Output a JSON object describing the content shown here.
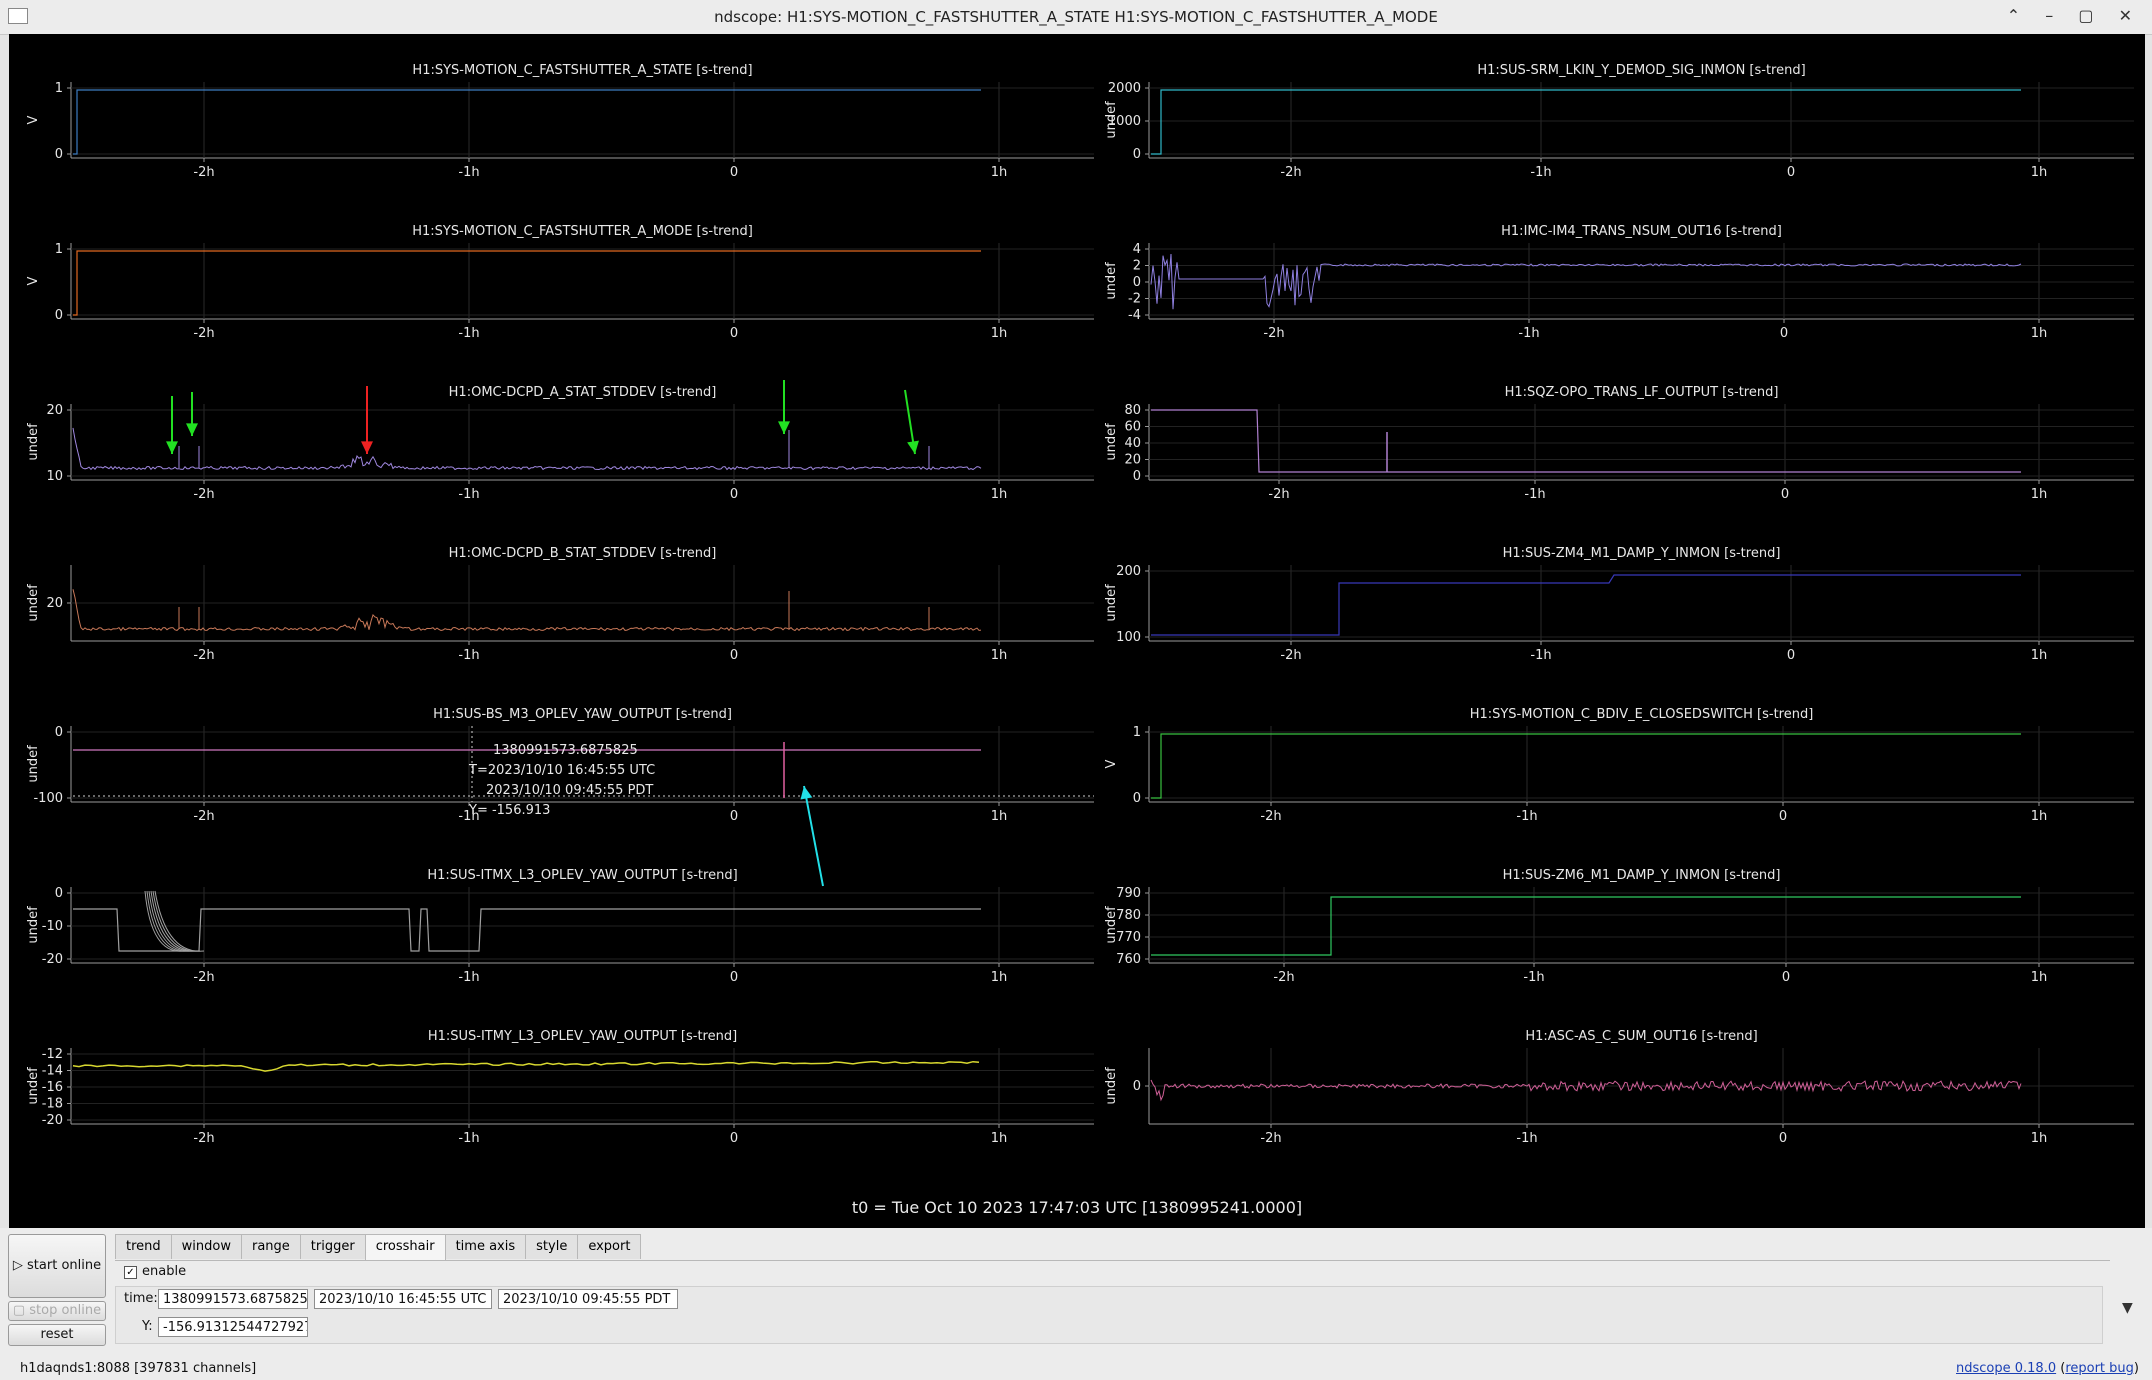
{
  "window": {
    "title": "ndscope: H1:SYS-MOTION_C_FASTSHUTTER_A_STATE H1:SYS-MOTION_C_FASTSHUTTER_A_MODE",
    "controls": [
      "⌃",
      "–",
      "▢",
      "✕"
    ]
  },
  "x_ticks": [
    "-2h",
    "-1h",
    "0",
    "1h"
  ],
  "plots": [
    {
      "title": "H1:SYS-MOTION_C_FASTSHUTTER_A_STATE [s-trend]",
      "ylabel": "V",
      "color": "#3d7cc0",
      "yticks": [
        "1",
        "0"
      ],
      "type": "step"
    },
    {
      "title": "H1:SUS-SRM_LKIN_Y_DEMOD_SIG_INMON [s-trend]",
      "ylabel": "undef",
      "color": "#30b8c8",
      "yticks": [
        "2000",
        "1000",
        "0"
      ],
      "type": "step"
    },
    {
      "title": "H1:SYS-MOTION_C_FASTSHUTTER_A_MODE [s-trend]",
      "ylabel": "V",
      "color": "#e06820",
      "yticks": [
        "1",
        "0"
      ],
      "type": "step"
    },
    {
      "title": "H1:IMC-IM4_TRANS_NSUM_OUT16 [s-trend]",
      "ylabel": "undef",
      "color": "#8f80e0",
      "yticks": [
        "4",
        "2",
        "0",
        "-2",
        "-4"
      ],
      "type": "noisy"
    },
    {
      "title": "H1:OMC-DCPD_A_STAT_STDDEV [s-trend]",
      "ylabel": "undef",
      "color": "#a088e0",
      "yticks": [
        "20",
        "10"
      ],
      "type": "spiky"
    },
    {
      "title": "H1:SQZ-OPO_TRANS_LF_OUTPUT [s-trend]",
      "ylabel": "undef",
      "color": "#b080d0",
      "yticks": [
        "80",
        "60",
        "40",
        "20",
        "0"
      ],
      "type": "dropstep"
    },
    {
      "title": "H1:OMC-DCPD_B_STAT_STDDEV [s-trend]",
      "ylabel": "undef",
      "color": "#c87858",
      "yticks": [
        "20"
      ],
      "type": "spiky"
    },
    {
      "title": "H1:SUS-ZM4_M1_DAMP_Y_INMON [s-trend]",
      "ylabel": "undef",
      "color": "#3838b8",
      "yticks": [
        "200",
        "100"
      ],
      "type": "step"
    },
    {
      "title": "H1:SUS-BS_M3_OPLEV_YAW_OUTPUT [s-trend]",
      "ylabel": "undef",
      "color": "#d078c0",
      "yticks": [
        "0",
        "-100"
      ],
      "type": "flat"
    },
    {
      "title": "H1:SYS-MOTION_C_BDIV_E_CLOSEDSWITCH [s-trend]",
      "ylabel": "V",
      "color": "#38c040",
      "yticks": [
        "1",
        "0"
      ],
      "type": "step"
    },
    {
      "title": "H1:SUS-ITMX_L3_OPLEV_YAW_OUTPUT [s-trend]",
      "ylabel": "undef",
      "color": "#a0a0a0",
      "yticks": [
        "0",
        "-10",
        "-20"
      ],
      "type": "square"
    },
    {
      "title": "H1:SUS-ZM6_M1_DAMP_Y_INMON [s-trend]",
      "ylabel": "undef",
      "color": "#30c860",
      "yticks": [
        "790",
        "780",
        "770",
        "760"
      ],
      "type": "step"
    },
    {
      "title": "H1:SUS-ITMY_L3_OPLEV_YAW_OUTPUT [s-trend]",
      "ylabel": "undef",
      "color": "#d8d830",
      "yticks": [
        "-12",
        "-14",
        "-16",
        "-18",
        "-20"
      ],
      "type": "wavy"
    },
    {
      "title": "H1:ASC-AS_C_SUM_OUT16 [s-trend]",
      "ylabel": "undef",
      "color": "#d06098",
      "yticks": [
        "0"
      ],
      "type": "noisy2"
    }
  ],
  "crosshair_readout": {
    "gps": "1380991573.6875825",
    "utc": "T=2023/10/10 16:45:55 UTC",
    "pdt": "2023/10/10 09:45:55 PDT",
    "y": "Y= -156.913"
  },
  "t0_label": "t0 = Tue Oct 10 2023 17:47:03 UTC [1380995241.0000]",
  "controls": {
    "start_online": "start online",
    "stop_online": "stop online",
    "reset": "reset",
    "tabs": [
      "trend",
      "window",
      "range",
      "trigger",
      "crosshair",
      "time axis",
      "style",
      "export"
    ],
    "active_tab": "crosshair",
    "enable_label": "enable",
    "enable_checked": "✓",
    "time_label": "time:",
    "time_gps": "1380991573.6875825",
    "time_utc": "2023/10/10 16:45:55 UTC",
    "time_pdt": "2023/10/10 09:45:55 PDT",
    "y_label": "Y:",
    "y_value": "-156.91312544727927",
    "collapse_icon": "▼"
  },
  "status": {
    "server": "h1daqnds1:8088  [397831 channels]",
    "version_text": "ndscope 0.18.0",
    "report_bug": "report bug"
  },
  "annotation_colors": {
    "green": "#22e022",
    "red": "#ee2222",
    "cyan": "#22e0e8"
  }
}
